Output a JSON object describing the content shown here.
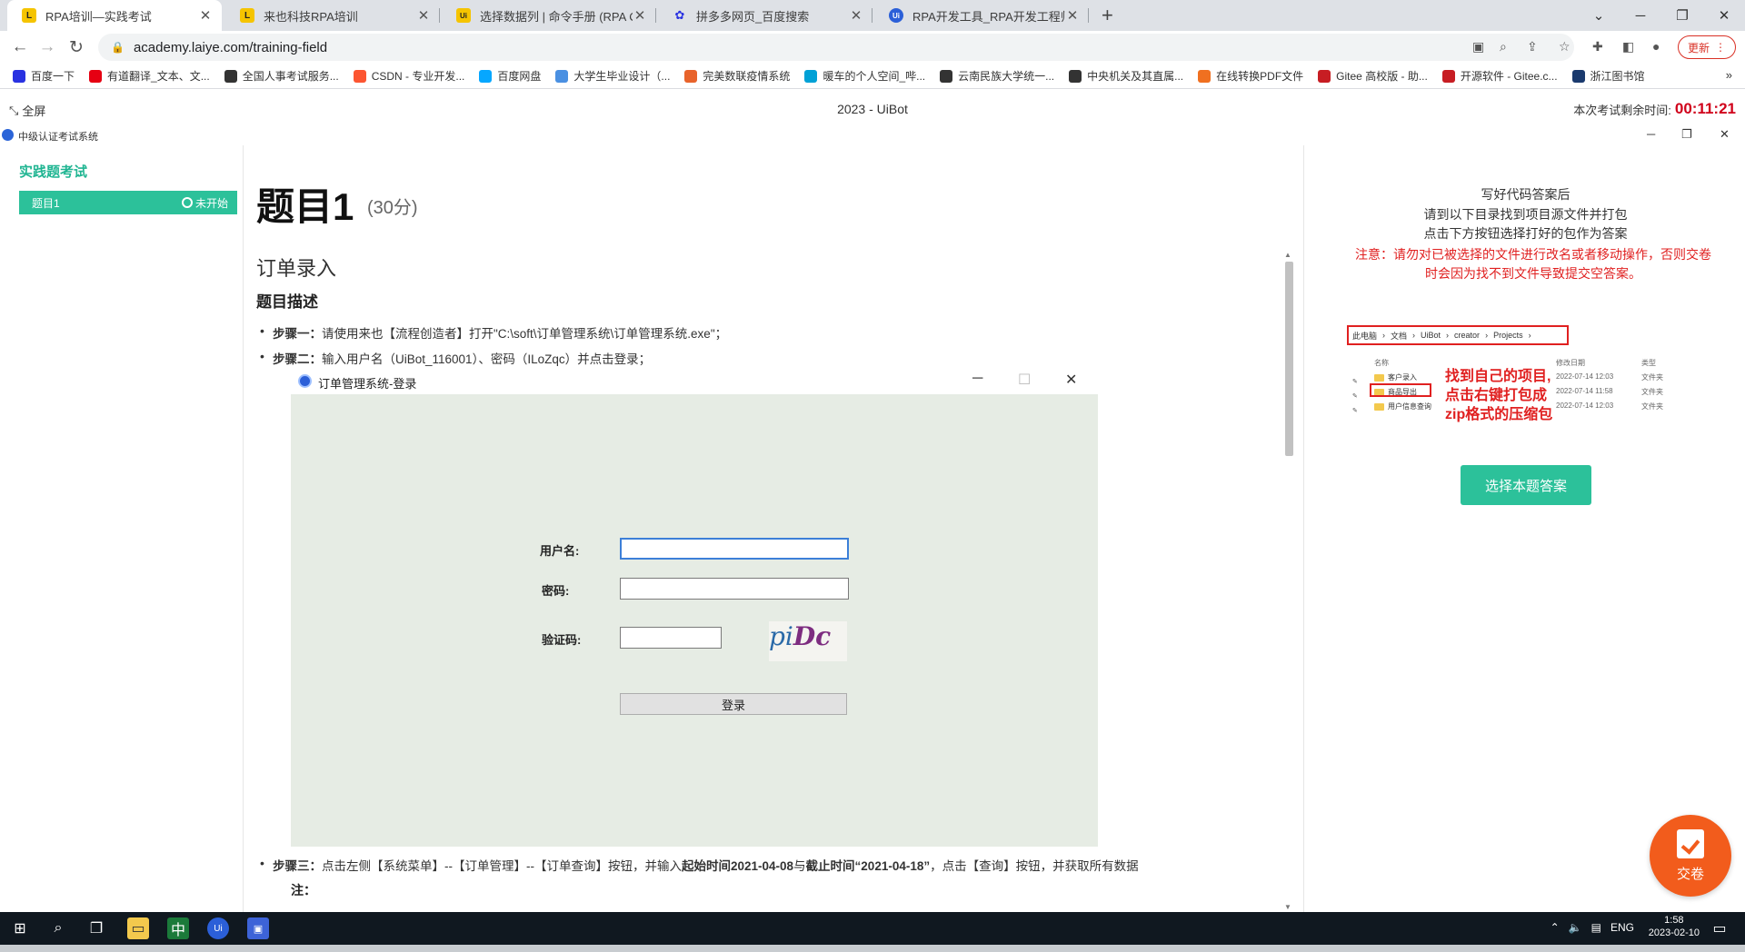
{
  "browser": {
    "tabs": [
      {
        "title": "RPA培训—实践考试",
        "icon": "laiye-icon",
        "active": true
      },
      {
        "title": "来也科技RPA培训",
        "icon": "laiye-icon"
      },
      {
        "title": "选择数据列 | 命令手册 (RPA Com",
        "icon": "uibot-doc-icon"
      },
      {
        "title": "拼多多网页_百度搜索",
        "icon": "baidu-paw-icon"
      },
      {
        "title": "RPA开发工具_RPA开发工程师交",
        "icon": "uibot-icon"
      }
    ],
    "new_tab": "+",
    "url": "academy.laiye.com/training-field",
    "update_label": "更新",
    "bookmarks": [
      {
        "label": "百度一下",
        "color": "#2932e1"
      },
      {
        "label": "有道翻译_文本、文...",
        "color": "#e60012"
      },
      {
        "label": "全国人事考试服务...",
        "color": "#333333"
      },
      {
        "label": "CSDN - 专业开发...",
        "color": "#fc5531"
      },
      {
        "label": "百度网盘",
        "color": "#06a7ff"
      },
      {
        "label": "大学生毕业设计（...",
        "color": "#4a90e2"
      },
      {
        "label": "完美数联疫情系统",
        "color": "#e8632b"
      },
      {
        "label": "暖车的个人空间_哔...",
        "color": "#00a1d6"
      },
      {
        "label": "云南民族大学统一...",
        "color": "#333333"
      },
      {
        "label": "中央机关及其直属...",
        "color": "#333333"
      },
      {
        "label": "在线转换PDF文件",
        "color": "#f07020"
      },
      {
        "label": "Gitee 高校版 - 助...",
        "color": "#c71d23"
      },
      {
        "label": "开源软件 - Gitee.c...",
        "color": "#c71d23"
      },
      {
        "label": "浙江图书馆",
        "color": "#1a3a6e"
      }
    ],
    "bookmarks_more": "»"
  },
  "app": {
    "fullscreen_label": "全屏",
    "title": "2023 - UiBot",
    "timer_label": "本次考试剩余时间:",
    "timer_value": "00:11:21",
    "system_name": "中级认证考试系统"
  },
  "sidebar": {
    "heading": "实践题考试",
    "items": [
      {
        "label": "题目1",
        "status": "未开始"
      }
    ]
  },
  "question": {
    "title": "题目1",
    "score": "(30分)",
    "section": "订单录入",
    "desc_heading": "题目描述",
    "step1_label": "步骤一：",
    "step1_text": "请使用来也【流程创造者】打开\"C:\\soft\\订单管理系统\\订单管理系统.exe\"；",
    "step2_label": "步骤二：",
    "step2_text": "输入用户名（UiBot_116001）、密码（ILoZqc）并点击登录；",
    "step3_label": "步骤三：",
    "step3_a": "点击左侧【系统菜单】--【订单管理】--【订单查询】按钮，并输入",
    "step3_b": "起始时间2021-04-08",
    "step3_c": "与",
    "step3_d": "截止时间“2021-04-18”",
    "step3_e": "，点击【查询】按钮，并获取所有数据",
    "note": "注："
  },
  "login_window": {
    "title": "订单管理系统-登录",
    "username_label": "用户名:",
    "password_label": "密码:",
    "captcha_label": "验证码:",
    "captcha_part1": "pi",
    "captcha_part2": "Dc",
    "login_button": "登录",
    "username_value": "",
    "password_value": "",
    "captcha_value": ""
  },
  "right_panel": {
    "instructions": [
      "写好代码答案后",
      "请到以下目录找到项目源文件并打包",
      "点击下方按钮选择打好的包作为答案"
    ],
    "warning": "注意：请勿对已被选择的文件进行改名或者移动操作，否则交卷时会因为找不到文件导致提交空答案。",
    "breadcrumb": [
      "此电脑",
      "文档",
      "UiBot",
      "creator",
      "Projects"
    ],
    "columns": [
      "名称",
      "修改日期",
      "类型"
    ],
    "files": [
      {
        "name": "客户录入",
        "date": "2022-07-14 12:03",
        "type": "文件夹"
      },
      {
        "name": "商品导出",
        "date": "2022-07-14 11:58",
        "type": "文件夹"
      },
      {
        "name": "用户信息查询",
        "date": "2022-07-14 12:03",
        "type": "文件夹"
      }
    ],
    "annotation": [
      "找到自己的项目,",
      "点击右键打包成",
      "zip格式的压缩包"
    ],
    "choose_button": "选择本题答案",
    "submit_button": "交卷"
  },
  "taskbar": {
    "lang": "ENG",
    "time": "1:58",
    "date": "2023-02-10"
  }
}
